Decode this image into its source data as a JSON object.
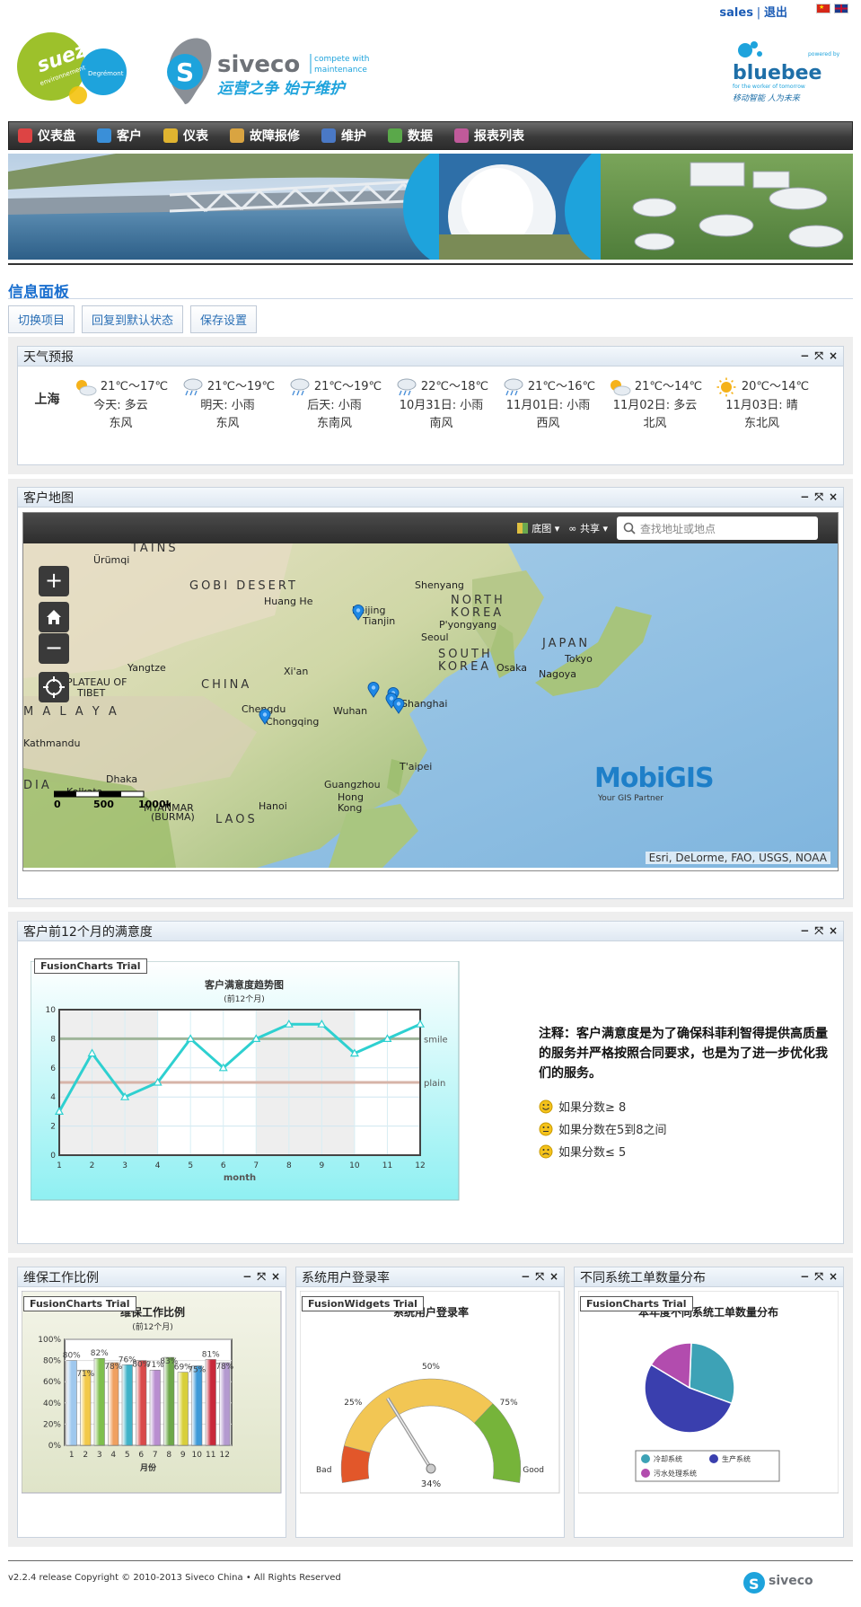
{
  "topbar": {
    "user": "sales",
    "separator": "|",
    "logout": "退出"
  },
  "logos": {
    "suez_top": "suez",
    "suez_sub": "environnement",
    "degremont": "Degrémont",
    "siveco_name": "siveco",
    "siveco_tag1": "compete with",
    "siveco_tag2": "maintenance",
    "siveco_slogan": "运营之争 始于维护",
    "bluebee_powered": "powered by",
    "bluebee_name": "bluebee",
    "bluebee_sub": "for the worker of tomorrow",
    "bluebee_slogan": "移动智能 人为未来"
  },
  "nav": [
    {
      "label": "仪表盘",
      "icon": "home-icon",
      "color": "#d44"
    },
    {
      "label": "客户",
      "icon": "globe-icon",
      "color": "#3a8fd8"
    },
    {
      "label": "仪表",
      "icon": "meter-icon",
      "color": "#e0b430"
    },
    {
      "label": "故障报修",
      "icon": "repair-icon",
      "color": "#d9a441"
    },
    {
      "label": "维护",
      "icon": "maintenance-icon",
      "color": "#4a79c6"
    },
    {
      "label": "数据",
      "icon": "data-icon",
      "color": "#5aa84a"
    },
    {
      "label": "报表列表",
      "icon": "report-icon",
      "color": "#c05a9a"
    }
  ],
  "page": {
    "title": "信息面板"
  },
  "buttons": {
    "switch": "切换项目",
    "reset": "回复到默认状态",
    "save": "保存设置"
  },
  "weather": {
    "title": "天气预报",
    "city": "上海",
    "days": [
      {
        "temp": "21℃～17℃",
        "desc": "今天: 多云",
        "wind": "东风",
        "icon": "cloudy-sun-icon"
      },
      {
        "temp": "21℃～19℃",
        "desc": "明天: 小雨",
        "wind": "东风",
        "icon": "light-rain-icon"
      },
      {
        "temp": "21℃～19℃",
        "desc": "后天: 小雨",
        "wind": "东南风",
        "icon": "light-rain-icon"
      },
      {
        "temp": "22℃～18℃",
        "desc": "10月31日: 小雨",
        "wind": "南风",
        "icon": "light-rain-icon"
      },
      {
        "temp": "21℃～16℃",
        "desc": "11月01日: 小雨",
        "wind": "西风",
        "icon": "light-rain-icon"
      },
      {
        "temp": "21℃～14℃",
        "desc": "11月02日: 多云",
        "wind": "北风",
        "icon": "cloudy-sun-icon"
      },
      {
        "temp": "20℃～14℃",
        "desc": "11月03日: 晴",
        "wind": "东北风",
        "icon": "sun-icon"
      }
    ]
  },
  "map": {
    "title": "客户地图",
    "basemap_label": "底图",
    "share_label": "共享",
    "search_placeholder": "查找地址或地点",
    "attribution": "Esri, DeLorme, FAO, USGS, NOAA",
    "brand": "MobiGIS",
    "brand_sub": "Your GIS Partner",
    "scale_labels": [
      "0",
      "500",
      "1000km"
    ],
    "labels": {
      "urumqi": "Ürümqi",
      "gobi": "GOBI DESERT",
      "tians": "TAINS",
      "shenyang": "Shenyang",
      "beijing": "Beijing",
      "tianjin": "Tianjin",
      "nkorea1": "NORTH",
      "nkorea2": "KOREA",
      "pyongyang": "P'yongyang",
      "seoul": "Seoul",
      "skorea1": "SOUTH",
      "skorea2": "KOREA",
      "japan": "JAPAN",
      "tokyo": "Tokyo",
      "osaka": "Osaka",
      "nagoya": "Nagoya",
      "china": "CHINA",
      "xian": "Xi'an",
      "plateau1": "PLATEAU OF",
      "plateau2": "TIBET",
      "chengdu": "Chengdu",
      "chongqing": "Chongqing",
      "wuhan": "Wuhan",
      "shanghai": "Shanghai",
      "kathmandu": "Kathmandu",
      "taipei": "T'aipei",
      "guangzhou": "Guangzhou",
      "hongkong1": "Hong",
      "hongkong2": "Kong",
      "dhaka": "Dhaka",
      "kolkata": "Kolkata",
      "hanoi": "Hanoi",
      "myanmar1": "MYANMAR",
      "myanmar2": "(BURMA)",
      "laos": "LAOS",
      "india": "DIA",
      "malaya": "M A L A Y A",
      "yangtze": "Yangtze",
      "huanghe": "Huang He"
    }
  },
  "satisfaction": {
    "title": "客户前12个月的满意度",
    "trial": "FusionCharts Trial",
    "note": "注释：客户满意度是为了确保科菲利智得提供高质量的服务并严格按照合同要求，也是为了进一步优化我们的服务。",
    "legend": [
      "如果分数≥ 8",
      "如果分数在5到8之间",
      "如果分数≤ 5"
    ]
  },
  "ratio": {
    "title": "维保工作比例",
    "trial": "FusionCharts Trial"
  },
  "login": {
    "title": "系统用户登录率",
    "trial": "FusionWidgets Trial"
  },
  "dist": {
    "title": "不同系统工单数量分布",
    "trial": "FusionCharts Trial"
  },
  "chart_data": [
    {
      "type": "line",
      "title": "客户满意度趋势图",
      "subtitle": "(前12个月)",
      "xlabel": "month",
      "ylabel": "",
      "x": [
        1,
        2,
        3,
        4,
        5,
        6,
        7,
        8,
        9,
        10,
        11,
        12
      ],
      "series": [
        {
          "values": [
            3,
            7,
            4,
            5,
            8,
            6,
            8,
            9,
            9,
            7,
            8,
            9
          ]
        }
      ],
      "ylim": [
        0,
        10
      ],
      "yticks": [
        0,
        2,
        4,
        6,
        8,
        10
      ],
      "trendlines": [
        {
          "value": 8,
          "label": "smile",
          "color": "#9fb59a"
        },
        {
          "value": 5,
          "label": "plain",
          "color": "#d7b4a8"
        }
      ],
      "line_color": "#2ed0d0"
    },
    {
      "type": "bar",
      "title": "维保工作比例",
      "subtitle": "(前12个月)",
      "xlabel": "月份",
      "categories": [
        "1",
        "2",
        "3",
        "4",
        "5",
        "6",
        "7",
        "8",
        "9",
        "10",
        "11",
        "12"
      ],
      "values": [
        80,
        71,
        82,
        78,
        76,
        80,
        71,
        83,
        69,
        75,
        81,
        78
      ],
      "ylim": [
        0,
        100
      ],
      "yticks": [
        "0%",
        "20%",
        "40%",
        "60%",
        "80%",
        "100%"
      ],
      "colors": [
        "#9fc8ee",
        "#f2c94a",
        "#7fbf4d",
        "#f0a060",
        "#3fb2c8",
        "#d94a4a",
        "#b98ed0",
        "#6ea84a",
        "#d8cf3a",
        "#3f9ad8",
        "#c8283a",
        "#b49ad0"
      ]
    },
    {
      "type": "gauge",
      "title": "系统用户登录率",
      "value": 34,
      "min_label": "Bad",
      "max_label": "Good",
      "ticks": [
        "25%",
        "50%",
        "75%"
      ],
      "value_label": "34%"
    },
    {
      "type": "pie",
      "title": "本年度不同系统工单数量分布",
      "slices": [
        {
          "name": "冷却系统",
          "value": 30,
          "color": "#3da2b6"
        },
        {
          "name": "生产系统",
          "value": 53,
          "color": "#3a3fae"
        },
        {
          "name": "污水处理系统",
          "value": 17,
          "color": "#b24cae"
        }
      ]
    }
  ],
  "footer": {
    "text": "v2.2.4 release Copyright © 2010-2013 Siveco China • All Rights Reserved",
    "logo": "siveco"
  }
}
